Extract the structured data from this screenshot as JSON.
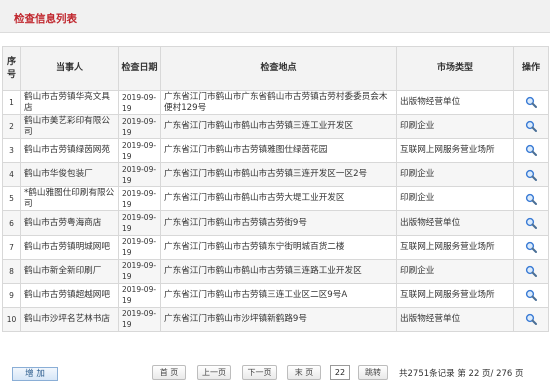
{
  "header": {
    "title": "检查信息列表"
  },
  "table": {
    "columns": [
      "序号",
      "当事人",
      "检查日期",
      "检查地点",
      "市场类型",
      "操作"
    ],
    "rows": [
      {
        "idx": "1",
        "party": "鹤山市古劳镇华亮文具店",
        "date": "2019-09-19",
        "location": "广东省江门市鹤山市广东省鹤山市古劳镇古劳村委委员会木便村129号",
        "market": "出版物经营单位"
      },
      {
        "idx": "2",
        "party": "鹤山市美艺彩印有限公司",
        "date": "2019-09-19",
        "location": "广东省江门市鹤山市鹤山市古劳镇三连工业开发区",
        "market": "印刷企业"
      },
      {
        "idx": "3",
        "party": "鹤山市古劳镇绿茵网苑",
        "date": "2019-09-19",
        "location": "广东省江门市鹤山市古劳镇雅图仕绿茵花园",
        "market": "互联网上网服务营业场所"
      },
      {
        "idx": "4",
        "party": "鹤山市华俊包装厂",
        "date": "2019-09-19",
        "location": "广东省江门市鹤山市鹤山市古劳镇三连开发区一区2号",
        "market": "印刷企业"
      },
      {
        "idx": "5",
        "party": "*鹤山雅图仕印刷有限公司",
        "date": "2019-09-19",
        "location": "广东省江门市鹤山市鹤山市古劳大堤工业开发区",
        "market": "印刷企业"
      },
      {
        "idx": "6",
        "party": "鹤山市古劳粤海商店",
        "date": "2019-09-19",
        "location": "广东省江门市鹤山市古劳镇古劳街9号",
        "market": "出版物经营单位"
      },
      {
        "idx": "7",
        "party": "鹤山市古劳镇明城网吧",
        "date": "2019-09-19",
        "location": "广东省江门市鹤山市古劳镇东宁街明城百货二楼",
        "market": "互联网上网服务营业场所"
      },
      {
        "idx": "8",
        "party": "鹤山市新全新印刷厂",
        "date": "2019-09-19",
        "location": "广东省江门市鹤山市鹤山市古劳镇三连路工业开发区",
        "market": "印刷企业"
      },
      {
        "idx": "9",
        "party": "鹤山市古劳镇超越网吧",
        "date": "2019-09-19",
        "location": "广东省江门市鹤山市古劳镇三连工业区二区9号A",
        "market": "互联网上网服务营业场所"
      },
      {
        "idx": "10",
        "party": "鹤山市沙坪名艺林书店",
        "date": "2019-09-19",
        "location": "广东省江门市鹤山市沙坪镇新鹤路9号",
        "market": "出版物经营单位"
      }
    ]
  },
  "footer": {
    "add_label": "增 加",
    "first_label": "首 页",
    "prev_label": "上一页",
    "next_label": "下一页",
    "last_label": "末 页",
    "page_value": "22",
    "goto_label": "跳转",
    "info": "共2751条记录 第 22 页/ 276 页"
  },
  "colors": {
    "title": "#c0262d",
    "header_bg": "#f3f3f3",
    "stripe": "#f6f6f6",
    "icon": "#3a7bd5"
  },
  "icons": {
    "view": "magnifier-icon"
  }
}
